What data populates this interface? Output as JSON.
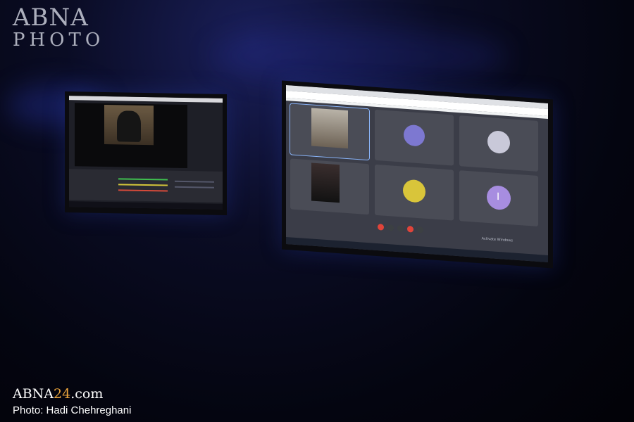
{
  "watermark": {
    "brand": "ABNA",
    "subtitle": "PHOTO"
  },
  "credit": {
    "site_main": "ABNA",
    "site_accent": "24",
    "site_tail": ".com",
    "photographer": "Photo: Hadi Chehreghani"
  },
  "right_screen": {
    "tile_initial": "I",
    "activate_notice": "Activate Windows"
  },
  "colors": {
    "accent": "#e8a23b",
    "meet_tile": "#4a4c56",
    "avatar_purple": "#a78de0",
    "avatar_blue": "#7d78d1",
    "avatar_yellow": "#d9c53a",
    "end_call_red": "#e0443a"
  }
}
